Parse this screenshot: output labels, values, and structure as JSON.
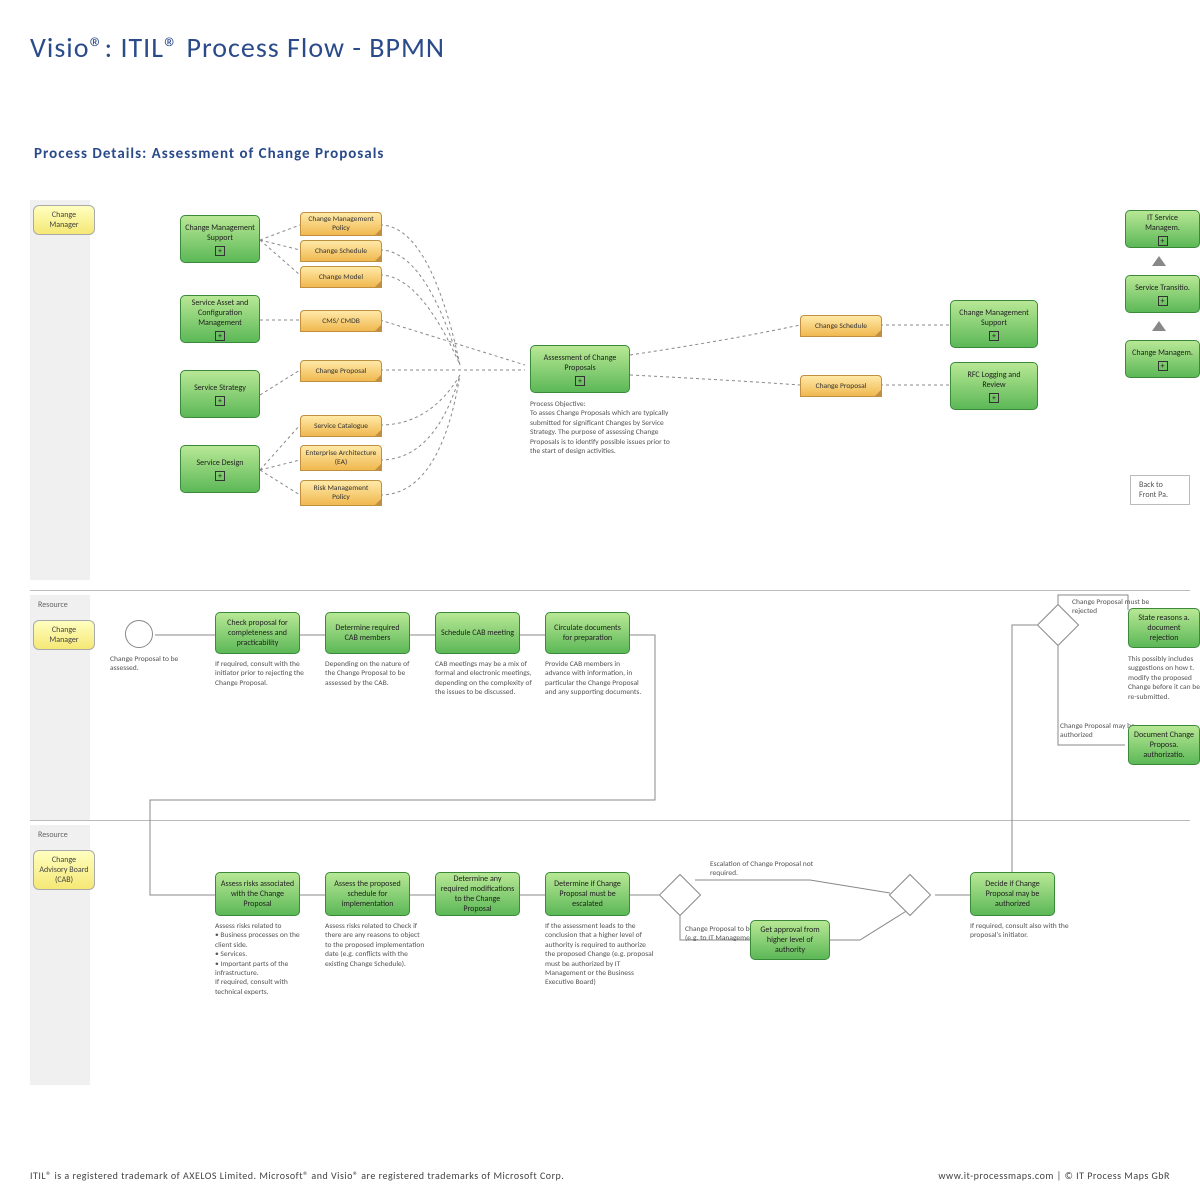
{
  "title": "Visio®: ITIL® Process Flow - BPMN",
  "subtitle": "Process Details: Assessment of Change Proposals",
  "footer": {
    "left": "ITIL® is a registered trademark of AXELOS Limited. Microsoft® and Visio® are registered trademarks of Microsoft Corp.",
    "right": "www.it-processmaps.com | © IT Process Maps GbR"
  },
  "upper": {
    "role": "Change Manager",
    "leftTasks": [
      "Change Management Support",
      "Service Asset and Configuration Management",
      "Service Strategy",
      "Service Design"
    ],
    "docs": [
      "Change Management Policy",
      "Change Schedule",
      "Change Model",
      "CMS/ CMDB",
      "Change Proposal",
      "Service Catalogue",
      "Enterprise Architecture (EA)",
      "Risk Management Policy"
    ],
    "center": "Assessment of Change Proposals",
    "centerNote": "Process Objective:\nTo asses Change Proposals which are typically submitted for significant Changes by Service Strategy. The purpose of assessing Change Proposals is to identify possible issues prior to the start of design activities.",
    "outDocs": [
      "Change Schedule",
      "Change Proposal"
    ],
    "rightTasks": [
      "Change Management Support",
      "RFC Logging and Review"
    ],
    "farRight": [
      "IT Service Managem.",
      "Service Transitio.",
      "Change Managem."
    ],
    "backBtn": "Back to Front Pa."
  },
  "lower": {
    "resLabel": "Resource",
    "role1": "Change Manager",
    "role2": "Change Advisory Board (CAB)",
    "startNote": "Change Proposal to be assessed.",
    "r1tasks": [
      "Check proposal for completeness and practicability",
      "Determine required CAB members",
      "Schedule CAB meeting",
      "Circulate documents for preparation"
    ],
    "r1notes": [
      "If required, consult with the initiator prior to rejecting the Change Proposal.",
      "Depending on the nature of the Change Proposal to be assessed by the CAB.",
      "CAB meetings may be a mix of formal and electronic meetings, depending on the complexity of the issues to be discussed.",
      "Provide CAB members in advance with information, in particular the Change Proposal and any supporting documents."
    ],
    "r2tasks": [
      "Assess risks associated with the Change Proposal",
      "Assess the proposed schedule for implementation",
      "Determine any required modifications to the Change Proposal",
      "Determine if Change Proposal must be escalated",
      "Get approval from higher level of authority",
      "Decide if Change Proposal may be authorized"
    ],
    "r2notes": [
      "Assess risks related to\n• Business processes on the client side.\n• Services.\n• Important parts of the infrastructure.\nIf required, consult with technical experts.",
      "Assess risks related to Check if there are any reasons to object to the proposed implementation date (e.g. conflicts with the existing Change Schedule).",
      "",
      "If the assessment leads to the conclusion that a higher level of authority is required to authorize the proposed Change (e.g. proposal must be authorized by IT Management or the Business Executive Board)"
    ],
    "gwLabels": [
      "Escalation of Change Proposal not required.",
      "Change Proposal to be escalated (e.g. to IT Management).",
      "Change Proposal must be rejected",
      "Change Proposal may be authorized"
    ],
    "decideNote": "If required, consult also with the proposal's initiator.",
    "endTasks": [
      "State reasons a. document rejection",
      "Document Change Proposa. authorizatio."
    ],
    "endNote": "This possibly includes suggestions on how t. modify the proposed Change before it can be re-submitted."
  }
}
